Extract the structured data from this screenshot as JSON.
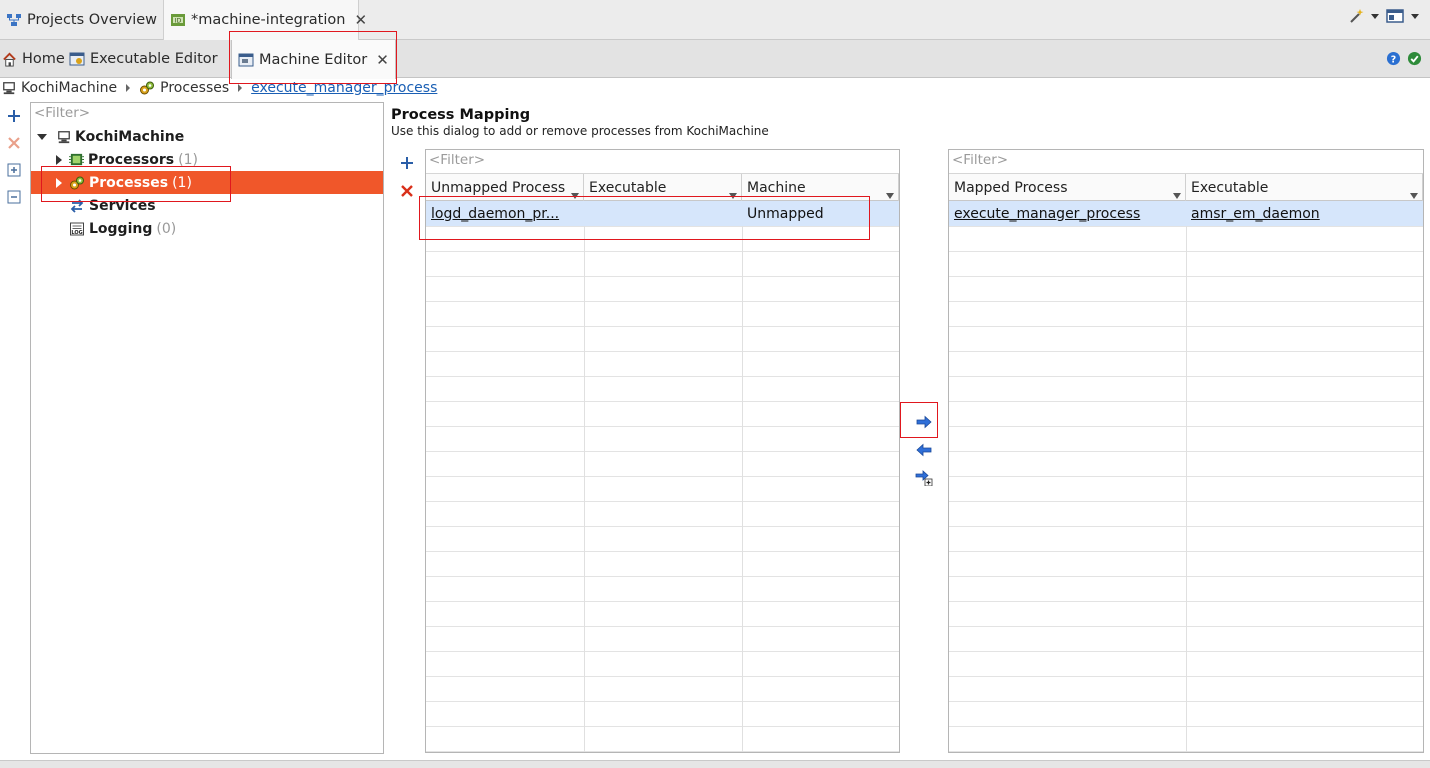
{
  "top_tabs": [
    {
      "label": "Projects Overview"
    },
    {
      "label": "*machine-integration"
    }
  ],
  "editor_tabs": [
    {
      "label": "Home"
    },
    {
      "label": "Executable Editor"
    },
    {
      "label": "Machine Editor"
    }
  ],
  "breadcrumb": {
    "machine": "KochiMachine",
    "section": "Processes",
    "current": "execute_manager_process"
  },
  "tree": {
    "filter_placeholder": "<Filter>",
    "root": "KochiMachine",
    "items": [
      {
        "label": "Processors",
        "count": "(1)"
      },
      {
        "label": "Processes",
        "count": "(1)"
      },
      {
        "label": "Services",
        "count": ""
      },
      {
        "label": "Logging",
        "count": "(0)"
      }
    ]
  },
  "mapping": {
    "title": "Process Mapping",
    "description": "Use this dialog to add or remove processes from KochiMachine"
  },
  "unmapped_table": {
    "filter_placeholder": "<Filter>",
    "columns": [
      "Unmapped Process",
      "Executable",
      "Machine"
    ],
    "rows": [
      {
        "process": "logd_daemon_pr...",
        "executable": "",
        "machine": "Unmapped"
      }
    ]
  },
  "mapped_table": {
    "filter_placeholder": "<Filter>",
    "columns": [
      "Mapped Process",
      "Executable"
    ],
    "rows": [
      {
        "process": "execute_manager_process",
        "executable": "amsr_em_daemon"
      }
    ]
  },
  "colors": {
    "selection": "#f0572a",
    "row_highlight": "#d6e6fb",
    "annotation": "#e0171e",
    "link": "#1a5fb4"
  },
  "icons": [
    "projects-overview-icon",
    "machine-integration-icon",
    "home-icon",
    "executable-editor-icon",
    "machine-editor-icon",
    "wand-icon",
    "perspective-icon",
    "help-icon",
    "check-icon",
    "add-icon",
    "delete-icon",
    "expand-all-icon",
    "collapse-all-icon",
    "map-right-arrow-icon",
    "unmap-left-arrow-icon",
    "map-add-icon"
  ]
}
